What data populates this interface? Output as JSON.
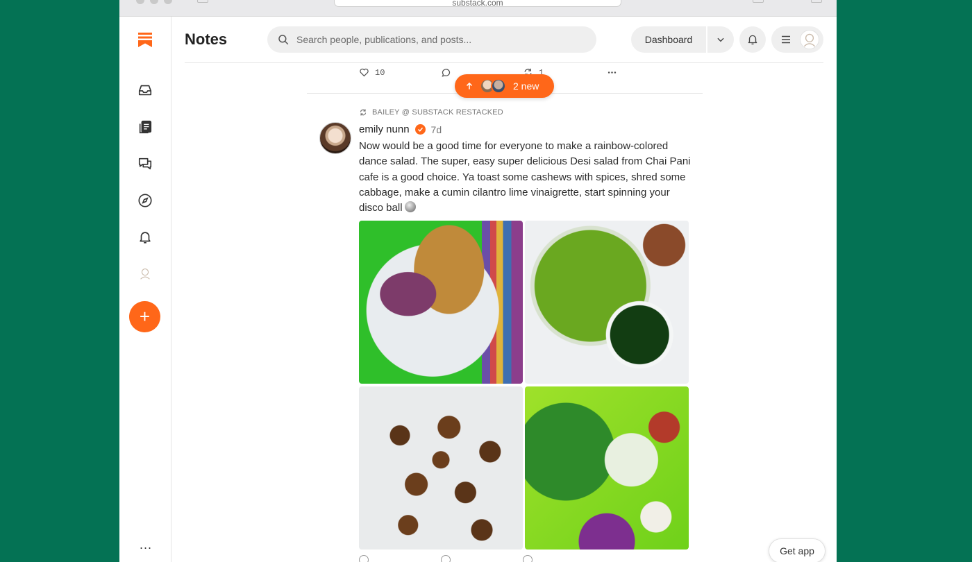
{
  "browser": {
    "url_text": "substack.com"
  },
  "sidebar": {
    "items": [
      {
        "icon": "inbox-icon"
      },
      {
        "icon": "reader-icon"
      },
      {
        "icon": "chat-icon"
      },
      {
        "icon": "compass-icon"
      },
      {
        "icon": "bell-icon"
      },
      {
        "icon": "profile-avatar-icon"
      }
    ],
    "fab_label": "+",
    "more_label": "..."
  },
  "header": {
    "title": "Notes",
    "search_placeholder": "Search people, publications, and posts...",
    "dashboard_label": "Dashboard"
  },
  "previous_post": {
    "likes": "10",
    "restacks": "1"
  },
  "new_pill": {
    "label": "2 new"
  },
  "post": {
    "restack_line": "BAILEY @ SUBSTACK RESTACKED",
    "author": "emily nunn",
    "age": "7d",
    "body": "Now would be a good time for everyone to make a rainbow-colored dance salad. The super, easy super delicious Desi salad from Chai Pani cafe is a good choice. Ya toast some cashews with spices, shred some cabbage, make a cumin cilantro lime vinaigrette, start spinning your disco ball"
  },
  "footer": {
    "get_app_label": "Get app"
  },
  "colors": {
    "background": "#047254",
    "accent": "#ff6719"
  }
}
